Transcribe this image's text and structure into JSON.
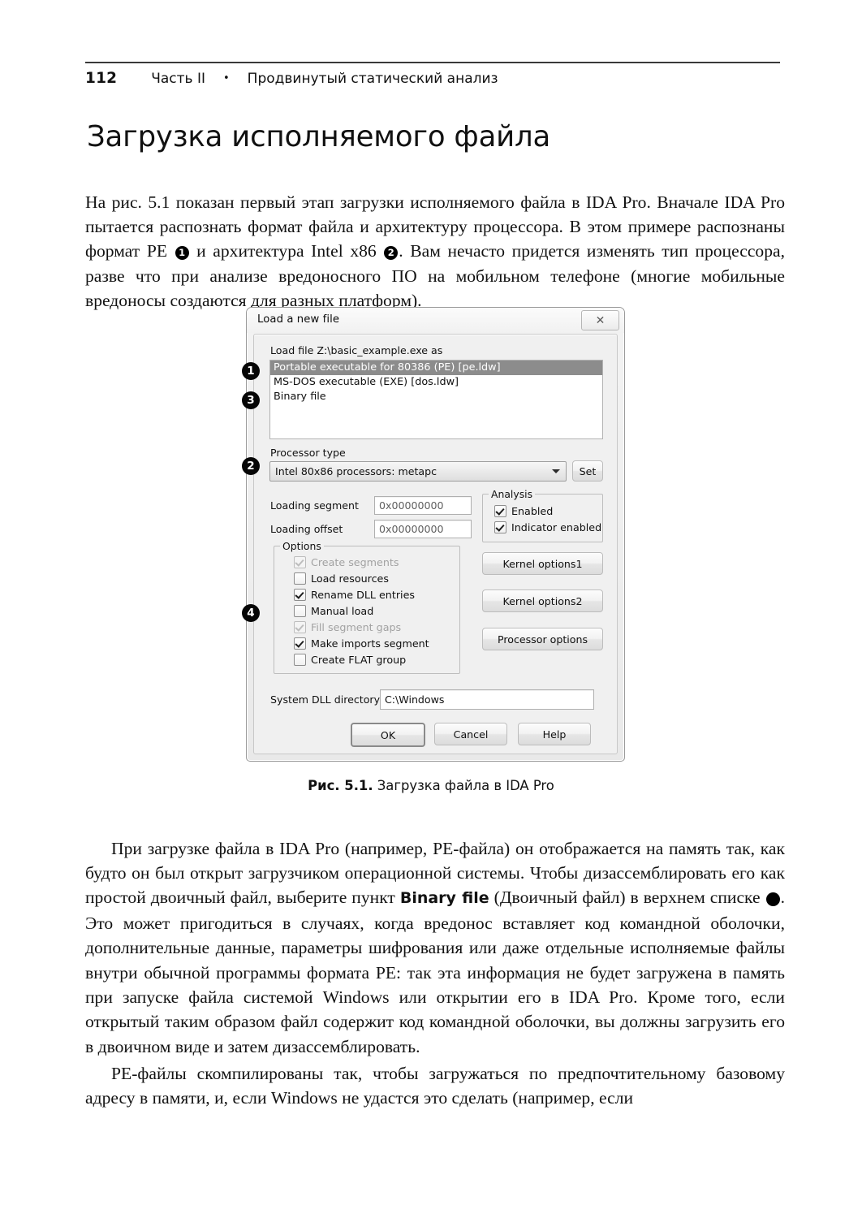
{
  "page": {
    "folio": "112",
    "running_head_part": "Часть II",
    "running_head_bullet": "•",
    "running_head_title": "Продвинутый статический анализ",
    "chapter_title": "Загрузка исполняемого файла"
  },
  "paragraphs": {
    "intro_a": "На рис. 5.1 показан первый этап загрузки исполняемого файла в IDA Pro. Вначале IDA Pro пытается распознать формат файла и архитектуру процессора. В этом примере распознаны формат PE ",
    "intro_b": " и архитектура Intel x86 ",
    "intro_c": ". Вам нечасто придется изменять тип процессора, разве что при анализе вредоносного ПО на мобильном телефоне (многие мобильные вредоносы создаются для разных платформ).",
    "body2_a": "При загрузке файла в IDA Pro (например, PE-файла) он отображается на память так, как будто он был открыт загрузчиком операционной системы. Чтобы дизассемблировать его как простой двоичный файл, выберите пункт ",
    "body2_term": "Binary file",
    "body2_b": " (Двоичный файл) в верхнем списке ",
    "body2_c": ". Это может пригодиться в случаях, когда вредонос вставляет код командной оболочки, дополнительные данные, параметры шифрования или даже отдельные исполняемые файлы внутри обычной программы формата PE: так эта информация не будет загружена в память при запуске файла системой Windows или открытии его в IDA Pro. Кроме того, если открытый таким образом файл содержит код командной оболочки, вы должны загрузить его в двоичном виде и затем дизассемблировать.",
    "body3": "PE-файлы скомпилированы так, чтобы загружаться по предпочтительному базовому адресу в памяти, и, если Windows не удастся это сделать (например, если"
  },
  "figure": {
    "caption_label": "Рис. 5.1.",
    "caption_text": "Загрузка файла в IDA Pro",
    "callouts": {
      "one": "1",
      "two": "2",
      "three": "3",
      "four": "4"
    }
  },
  "dialog": {
    "title": "Load a new file",
    "close_glyph": "✕",
    "load_file_label": "Load file Z:\\basic_example.exe as",
    "file_types": [
      {
        "label": "Portable executable for 80386 (PE) [pe.ldw]",
        "selected": true
      },
      {
        "label": "MS-DOS executable (EXE) [dos.ldw]",
        "selected": false
      },
      {
        "label": "Binary file",
        "selected": false
      }
    ],
    "processor_type_label": "Processor type",
    "processor_type_value": "Intel 80x86 processors: metapc",
    "set_button": "Set",
    "loading_segment_label": "Loading segment",
    "loading_segment_value": "0x00000000",
    "loading_offset_label": "Loading offset",
    "loading_offset_value": "0x00000000",
    "analysis_group": "Analysis",
    "analysis_options": [
      {
        "label": "Enabled",
        "checked": true,
        "disabled": false
      },
      {
        "label": "Indicator enabled",
        "checked": true,
        "disabled": false
      }
    ],
    "options_group": "Options",
    "options": [
      {
        "label": "Create segments",
        "checked": true,
        "disabled": true
      },
      {
        "label": "Load resources",
        "checked": false,
        "disabled": false
      },
      {
        "label": "Rename DLL entries",
        "checked": true,
        "disabled": false
      },
      {
        "label": "Manual load",
        "checked": false,
        "disabled": false
      },
      {
        "label": "Fill segment gaps",
        "checked": true,
        "disabled": true
      },
      {
        "label": "Make imports segment",
        "checked": true,
        "disabled": false
      },
      {
        "label": "Create FLAT group",
        "checked": false,
        "disabled": false
      }
    ],
    "kernel_options1": "Kernel options1",
    "kernel_options2": "Kernel options2",
    "processor_options": "Processor options",
    "system_dll_label": "System DLL directory",
    "system_dll_value": "C:\\Windows",
    "ok_button": "OK",
    "cancel_button": "Cancel",
    "help_button": "Help"
  },
  "colors": {
    "selection": "#8c8c8c",
    "dialog_face": "#f0f0f0",
    "callout_bg": "#050505"
  }
}
